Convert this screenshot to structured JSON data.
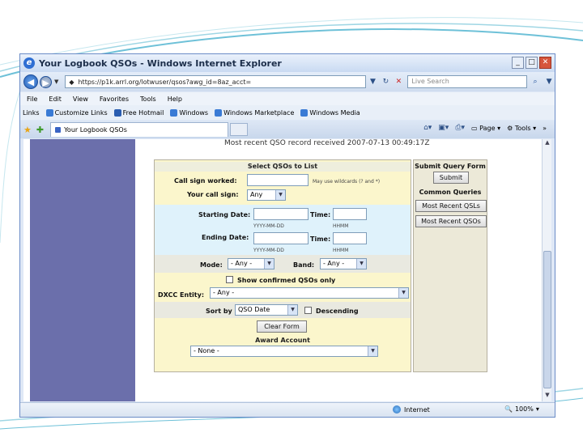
{
  "window": {
    "title": "Your Logbook QSOs - Windows Internet Explorer",
    "controls": [
      "_",
      "□",
      "✕"
    ]
  },
  "address": {
    "url": "https://p1k.arrl.org/lotwuser/qsos?awg_id=8az_acct=",
    "search_placeholder": "Live Search"
  },
  "menu": {
    "items": [
      "File",
      "Edit",
      "View",
      "Favorites",
      "Tools",
      "Help"
    ]
  },
  "links": {
    "label": "Links",
    "items": [
      "Customize Links",
      "Free Hotmail",
      "Windows",
      "Windows Marketplace",
      "Windows Media"
    ]
  },
  "tabs": {
    "active": "Your Logbook QSOs",
    "page_menu": "Page",
    "tools_menu": "Tools",
    "more": "»"
  },
  "page": {
    "recent_record": "Most recent QSO record received 2007-07-13 00:49:17Z"
  },
  "form": {
    "heading": "Select QSOs to List",
    "call_worked_label": "Call sign worked:",
    "call_worked_value": "",
    "wildcards_hint": "May use wildcards (? and *)",
    "your_call_label": "Your call sign:",
    "your_call_value": "Any",
    "starting_date_label": "Starting Date:",
    "ending_date_label": "Ending Date:",
    "time_label": "Time:",
    "date_hint": "YYYY-MM-DD",
    "time_hint": "HHMM",
    "mode_label": "Mode:",
    "mode_value": "- Any -",
    "band_label": "Band:",
    "band_value": "- Any -",
    "confirmed_label": "Show confirmed QSOs only",
    "dxcc_label": "DXCC Entity:",
    "dxcc_value": "- Any -",
    "sort_label": "Sort by",
    "sort_value": "QSO Date",
    "descending_label": "Descending",
    "clear_button": "Clear Form",
    "award_heading": "Award Account",
    "award_value": "- None -"
  },
  "side": {
    "submit_heading": "Submit Query Form",
    "submit_button": "Submit",
    "common_heading": "Common Queries",
    "recent_qsls": "Most Recent QSLs",
    "recent_qsos": "Most Recent QSOs"
  },
  "status": {
    "zone": "Internet",
    "zoom": "100%"
  }
}
